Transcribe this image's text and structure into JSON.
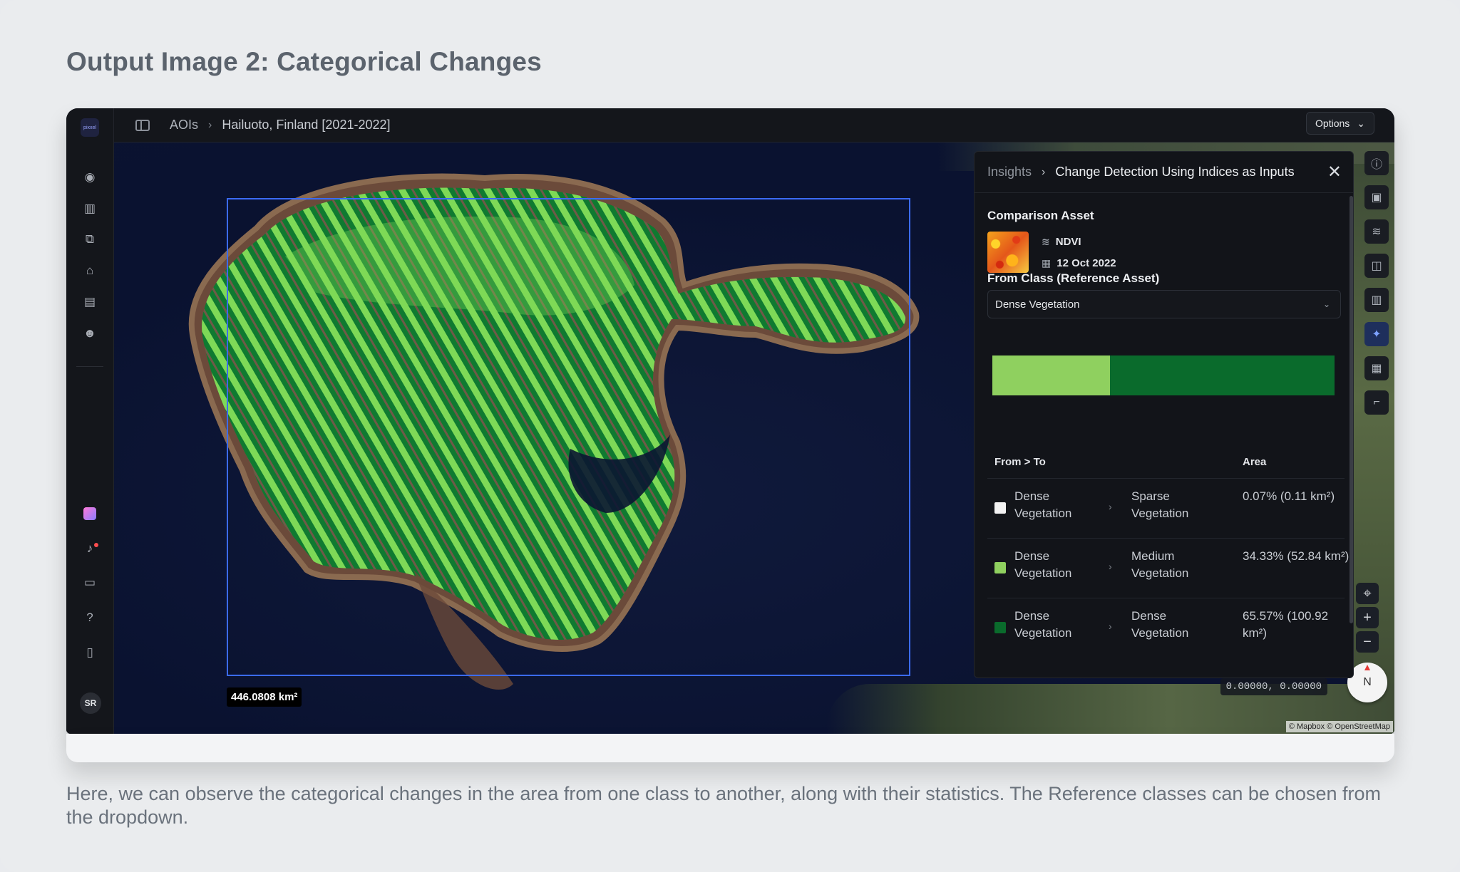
{
  "page": {
    "heading": "Output Image 2: Categorical Changes",
    "caption": "Here, we can observe the categorical changes in the area from one class to another, along with their statistics. The Reference classes can be chosen from the dropdown."
  },
  "app": {
    "logo_text": "pixxel",
    "breadcrumb": [
      "AOIs",
      "Hailuoto, Finland [2021-2022]"
    ],
    "options_label": "Options",
    "user_initials": "SR",
    "rail_icons": [
      "compass-icon",
      "map-icon",
      "workflow-icon",
      "store-icon",
      "inbox-icon",
      "team-icon"
    ],
    "rail_bottom_icons": [
      "apps-icon",
      "bell-icon",
      "feedback-icon",
      "help-icon",
      "docs-icon"
    ],
    "tools": [
      "info-icon",
      "image-icon",
      "layers-icon",
      "compare-icon",
      "chart-icon",
      "sparkle-icon",
      "map-layers-icon",
      "measure-icon"
    ]
  },
  "map": {
    "area_label": "446.0808 km²",
    "coordinates": "0.00000, 0.00000",
    "attribution": "© Mapbox © OpenStreetMap",
    "compass_label": "N",
    "colors": {
      "medium": "#7ed957",
      "dense": "#0f7a30",
      "water": "#0b1532",
      "aoi_border": "#3b6bff"
    }
  },
  "insights": {
    "breadcrumb_root": "Insights",
    "title": "Change Detection Using Indices as Inputs",
    "comparison_label": "Comparison Asset",
    "asset_name": "NDVI",
    "asset_date": "12 Oct 2022",
    "from_class_label": "From Class (Reference Asset)",
    "from_class_value": "Dense Vegetation",
    "bar": {
      "medium_fraction": 0.3433,
      "dense_fraction": 0.6557,
      "sparse_fraction": 0.0007
    },
    "table": {
      "headers": [
        "From > To",
        "Area"
      ],
      "rows": [
        {
          "from": "Dense Vegetation",
          "to": "Sparse Vegetation",
          "area": "0.07% (0.11 km²)",
          "color": "#f2f2f2"
        },
        {
          "from": "Dense Vegetation",
          "to": "Medium Vegetation",
          "area": "34.33% (52.84 km²)",
          "color": "#8fd05f"
        },
        {
          "from": "Dense Vegetation",
          "to": "Dense Vegetation",
          "area": "65.57% (100.92 km²)",
          "color": "#0a6b2c"
        }
      ]
    }
  }
}
